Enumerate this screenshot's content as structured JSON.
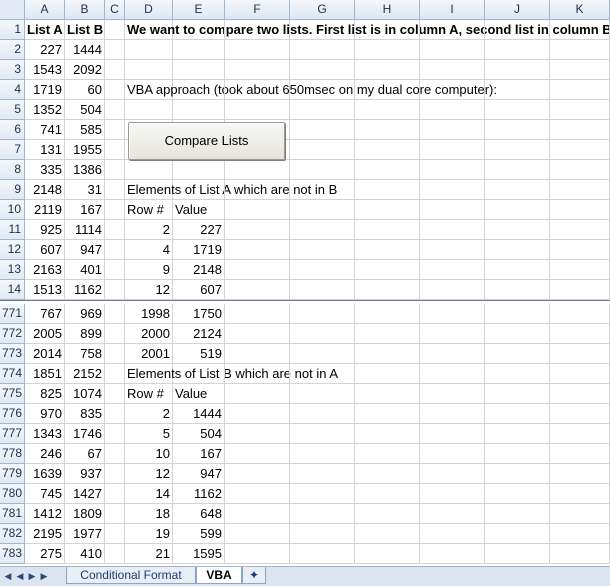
{
  "columns": [
    "A",
    "B",
    "C",
    "D",
    "E",
    "F",
    "G",
    "H",
    "I",
    "J",
    "K"
  ],
  "top_rows": [
    {
      "num": "1",
      "a": "List A",
      "b": "List B",
      "d": "We want to compare two lists. First list is in column A, second list in column B:",
      "e": ""
    },
    {
      "num": "2",
      "a": "227",
      "b": "1444",
      "d": "",
      "e": ""
    },
    {
      "num": "3",
      "a": "1543",
      "b": "2092",
      "d": "",
      "e": ""
    },
    {
      "num": "4",
      "a": "1719",
      "b": "60",
      "d": "VBA approach (took about 650msec on my dual core computer):",
      "e": ""
    },
    {
      "num": "5",
      "a": "1352",
      "b": "504",
      "d": "",
      "e": ""
    },
    {
      "num": "6",
      "a": "741",
      "b": "585",
      "d": "",
      "e": ""
    },
    {
      "num": "7",
      "a": "131",
      "b": "1955",
      "d": "",
      "e": ""
    },
    {
      "num": "8",
      "a": "335",
      "b": "1386",
      "d": "",
      "e": ""
    },
    {
      "num": "9",
      "a": "2148",
      "b": "31",
      "d": "Elements of List A which are not in B",
      "e": ""
    },
    {
      "num": "10",
      "a": "2119",
      "b": "167",
      "d": "Row #",
      "e": "Value"
    },
    {
      "num": "11",
      "a": "925",
      "b": "1114",
      "d": "2",
      "e": "227"
    },
    {
      "num": "12",
      "a": "607",
      "b": "947",
      "d": "4",
      "e": "1719"
    },
    {
      "num": "13",
      "a": "2163",
      "b": "401",
      "d": "9",
      "e": "2148"
    },
    {
      "num": "14",
      "a": "1513",
      "b": "1162",
      "d": "12",
      "e": "607"
    }
  ],
  "bottom_rows": [
    {
      "num": "771",
      "a": "767",
      "b": "969",
      "d": "1998",
      "e": "1750"
    },
    {
      "num": "772",
      "a": "2005",
      "b": "899",
      "d": "2000",
      "e": "2124"
    },
    {
      "num": "773",
      "a": "2014",
      "b": "758",
      "d": "2001",
      "e": "519"
    },
    {
      "num": "774",
      "a": "1851",
      "b": "2152",
      "d": "Elements of List B which are not in A",
      "e": ""
    },
    {
      "num": "775",
      "a": "825",
      "b": "1074",
      "d": "Row #",
      "e": "Value"
    },
    {
      "num": "776",
      "a": "970",
      "b": "835",
      "d": "2",
      "e": "1444"
    },
    {
      "num": "777",
      "a": "1343",
      "b": "1746",
      "d": "5",
      "e": "504"
    },
    {
      "num": "778",
      "a": "246",
      "b": "67",
      "d": "10",
      "e": "167"
    },
    {
      "num": "779",
      "a": "1639",
      "b": "937",
      "d": "12",
      "e": "947"
    },
    {
      "num": "780",
      "a": "745",
      "b": "1427",
      "d": "14",
      "e": "1162"
    },
    {
      "num": "781",
      "a": "1412",
      "b": "1809",
      "d": "18",
      "e": "648"
    },
    {
      "num": "782",
      "a": "2195",
      "b": "1977",
      "d": "19",
      "e": "599"
    },
    {
      "num": "783",
      "a": "275",
      "b": "410",
      "d": "21",
      "e": "1595"
    }
  ],
  "button": {
    "label": "Compare Lists"
  },
  "tabs": [
    {
      "label": "Conditional Format",
      "active": false
    },
    {
      "label": "VBA",
      "active": true
    }
  ]
}
